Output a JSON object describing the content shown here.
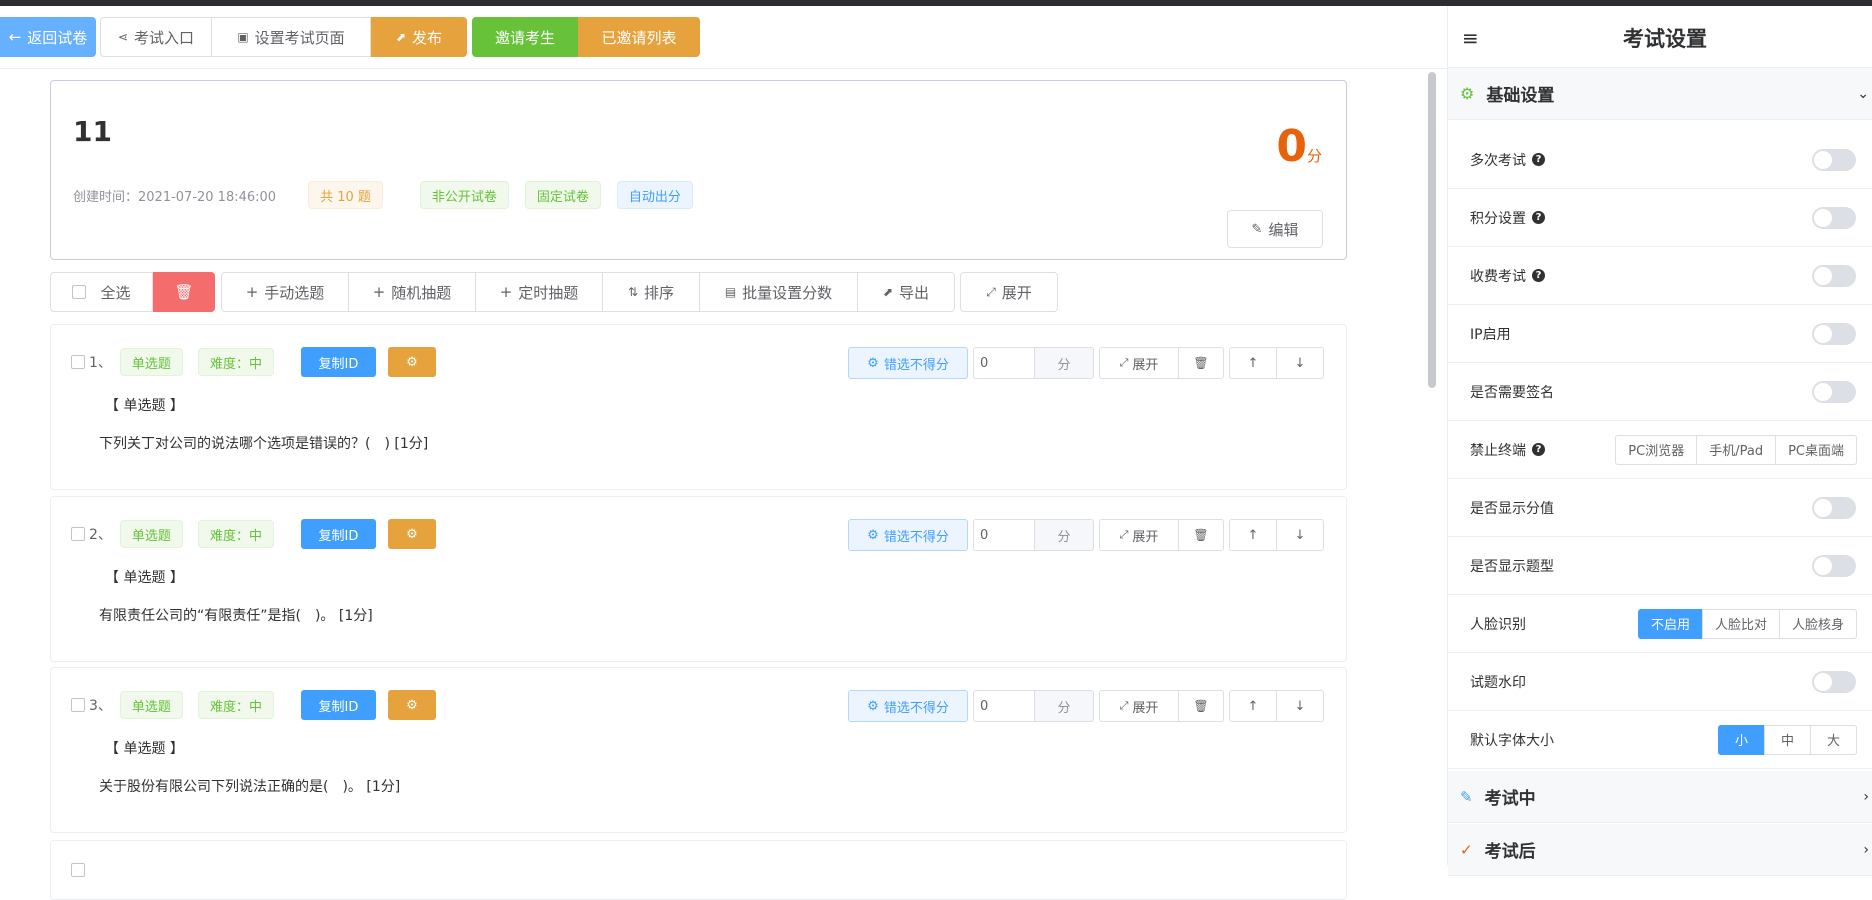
{
  "toolbar": {
    "back": "返回试卷",
    "entry": "考试入口",
    "setpage": "设置考试页面",
    "publish": "发布",
    "invite": "邀请考生",
    "invited": "已邀请列表"
  },
  "paper": {
    "title": "11",
    "score": "0",
    "score_unit": "分",
    "created": "创建时间：2021-07-20 18:46:00",
    "tags": [
      "共 10 题",
      "非公开试卷",
      "固定试卷",
      "自动出分"
    ],
    "edit": "编辑"
  },
  "qtool": {
    "select_all": "全选",
    "manual": "手动选题",
    "random": "随机抽题",
    "timed": "定时抽题",
    "sort": "排序",
    "batch": "批量设置分数",
    "export": "导出",
    "expand": "展开"
  },
  "questions": [
    {
      "num": "1、",
      "type": "单选题",
      "difficulty": "难度：中",
      "copy": "复制ID",
      "wrong": "错选不得分",
      "score": "0",
      "unit": "分",
      "expand": "展开",
      "type_label": "【 单选题 】",
      "text": "下列关丁对公司的说法哪个选项是错误的？(　) [1分]"
    },
    {
      "num": "2、",
      "type": "单选题",
      "difficulty": "难度：中",
      "copy": "复制ID",
      "wrong": "错选不得分",
      "score": "0",
      "unit": "分",
      "expand": "展开",
      "type_label": "【 单选题 】",
      "text": "有限责任公司的“有限责任”是指(　)。 [1分]"
    },
    {
      "num": "3、",
      "type": "单选题",
      "difficulty": "难度：中",
      "copy": "复制ID",
      "wrong": "错选不得分",
      "score": "0",
      "unit": "分",
      "expand": "展开",
      "type_label": "【 单选题 】",
      "text": "关于股份有限公司下列说法正确的是(　)。 [1分]"
    }
  ],
  "settings": {
    "title": "考试设置",
    "basic": "基础设置",
    "rows": [
      "多次考试",
      "积分设置",
      "收费考试",
      "IP启用",
      "是否需要签名",
      "禁止终端",
      "是否显示分值",
      "是否显示题型",
      "人脸识别",
      "试题水印",
      "默认字体大小"
    ],
    "terminal_options": [
      "PC浏览器",
      "手机/Pad",
      "PC桌面端"
    ],
    "face_options": [
      "不启用",
      "人脸比对",
      "人脸核身"
    ],
    "font_options": [
      "小",
      "中",
      "大"
    ],
    "during": "考试中",
    "after": "考试后"
  },
  "colors": {
    "primary": "#409eff",
    "warning": "#e6a23c",
    "success": "#67c23a",
    "danger": "#f56c6c",
    "score": "#e6630c"
  }
}
